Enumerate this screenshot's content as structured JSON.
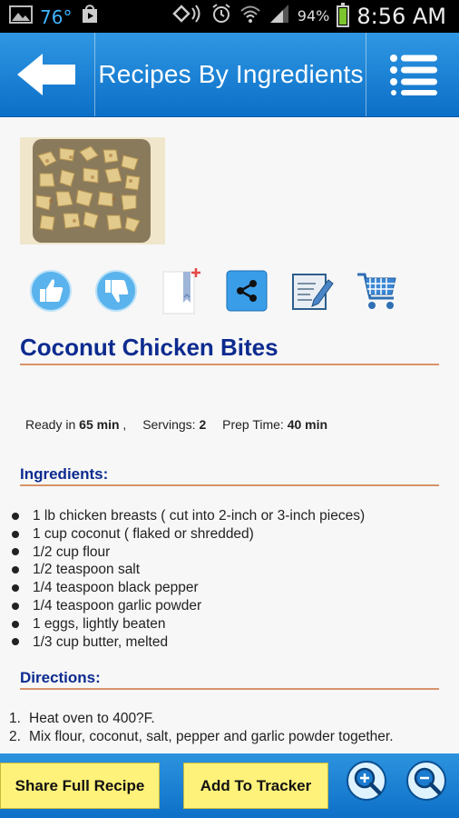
{
  "status": {
    "temperature": "76°",
    "battery_percent": "94%",
    "time": "8:56 AM"
  },
  "appbar": {
    "title": "Recipes By Ingredients",
    "back_icon": "back-arrow-icon",
    "menu_icon": "list-menu-icon"
  },
  "recipe": {
    "title": "Coconut Chicken Bites",
    "meta": {
      "ready_label": "Ready in",
      "ready_value": "65 min",
      "ready_suffix": ",",
      "servings_label": "Servings:",
      "servings_value": "2",
      "prep_label": "Prep Time:",
      "prep_value": "40 min"
    },
    "ingredients_heading": "Ingredients:",
    "ingredients": [
      "1 lb chicken breasts ( cut into 2-inch or 3-inch pieces)",
      "1 cup coconut ( flaked or shredded)",
      "1/2 cup flour",
      "1/2 teaspoon salt",
      "1/4 teaspoon black pepper",
      "1/4 teaspoon garlic powder",
      "1 eggs, lightly beaten",
      "1/3 cup butter, melted"
    ],
    "directions_heading": "Directions:",
    "directions": [
      {
        "num": "1.",
        "text": "Heat oven to 400?F."
      },
      {
        "num": "2.",
        "text": "Mix flour, coconut, salt, pepper and garlic powder together."
      }
    ]
  },
  "actions": [
    "thumbs-up-icon",
    "thumbs-down-icon",
    "bookmark-add-icon",
    "share-icon",
    "notes-edit-icon",
    "shopping-cart-icon"
  ],
  "bottom": {
    "share_label": "Share Full Recipe",
    "tracker_label": "Add To Tracker",
    "zoom_in_icon": "zoom-in-icon",
    "zoom_out_icon": "zoom-out-icon"
  },
  "colors": {
    "header_blue": "#1a82d6",
    "title_navy": "#0d2b8f",
    "rule_orange": "#d8936a",
    "button_yellow": "#fff27a"
  }
}
